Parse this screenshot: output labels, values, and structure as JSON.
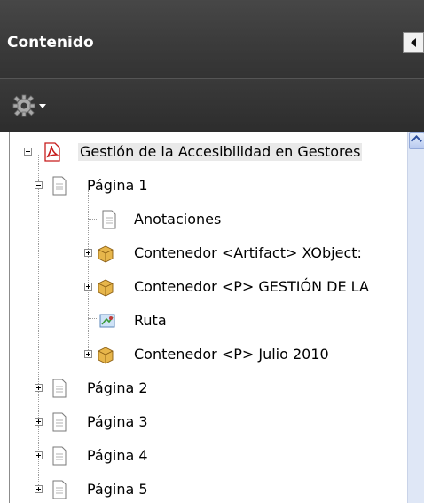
{
  "panel": {
    "title": "Contenido",
    "options_icon": "gear-icon",
    "collapse_icon": "collapse-left-icon"
  },
  "tree": {
    "root": {
      "label": "Gestión de la Accesibilidad en Gestores",
      "icon": "pdf-icon",
      "expanded": true
    },
    "page1": {
      "label": "Página 1",
      "icon": "page-icon",
      "expanded": true
    },
    "children": [
      {
        "label": "Anotaciones",
        "icon": "page-icon"
      },
      {
        "label": "Contenedor <Artifact> XObject:",
        "icon": "container-icon"
      },
      {
        "label": "Contenedor <P> GESTIÓN DE LA",
        "icon": "container-icon"
      },
      {
        "label": "Ruta",
        "icon": "path-icon"
      },
      {
        "label": "Contenedor <P> Julio 2010",
        "icon": "container-icon"
      }
    ],
    "pages": [
      {
        "label": "Página 2",
        "icon": "page-icon"
      },
      {
        "label": "Página 3",
        "icon": "page-icon"
      },
      {
        "label": "Página 4",
        "icon": "page-icon"
      },
      {
        "label": "Página 5",
        "icon": "page-icon"
      }
    ]
  }
}
